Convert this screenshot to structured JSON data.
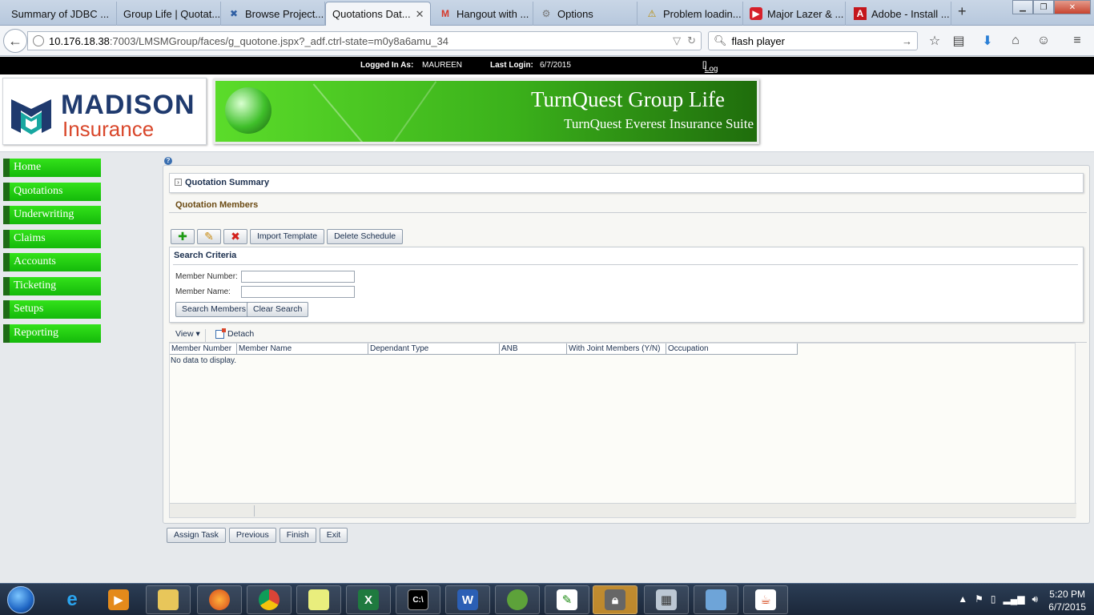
{
  "browser": {
    "tabs": [
      {
        "label": "Summary of JDBC ...",
        "icon": "page-icon"
      },
      {
        "label": "Group Life | Quotat...",
        "icon": "page-icon"
      },
      {
        "label": "Browse Project...",
        "icon": "jira-icon"
      },
      {
        "label": "Quotations Dat...",
        "icon": "page-icon",
        "active": true
      },
      {
        "label": "Hangout with ...",
        "icon": "gmail-icon"
      },
      {
        "label": "Options",
        "icon": "gear-icon"
      },
      {
        "label": "Problem loadin...",
        "icon": "warning-icon"
      },
      {
        "label": "Major Lazer & ...",
        "icon": "youtube-icon"
      },
      {
        "label": "Adobe - Install ...",
        "icon": "adobe-icon"
      }
    ],
    "url_host": "10.176.18.38",
    "url_rest": ":7003/LMSMGroup/faces/g_quotone.jspx?_adf.ctrl-state=m0y8a6amu_34",
    "search_value": "flash player"
  },
  "session": {
    "logged_in_label": "Logged In As:",
    "user": "MAUREEN",
    "last_login_label": "Last Login:",
    "last_login": "6/7/2015",
    "logout": "Log Out"
  },
  "branding": {
    "logo_line1": "MADISON",
    "logo_line2": "Insurance",
    "banner_title": "TurnQuest Group Life",
    "banner_subtitle": "TurnQuest Everest Insurance Suite"
  },
  "menu": [
    {
      "label": "Home"
    },
    {
      "label": "Quotations"
    },
    {
      "label": "Underwriting"
    },
    {
      "label": "Claims"
    },
    {
      "label": "Accounts"
    },
    {
      "label": "Ticketing"
    },
    {
      "label": "Setups"
    },
    {
      "label": "Reporting"
    }
  ],
  "main": {
    "help": "?",
    "summary_title": "Quotation Summary",
    "section_title": "Quotation Members",
    "toolbar": {
      "import_template": "Import Template",
      "delete_schedule": "Delete Schedule"
    },
    "search": {
      "title": "Search Criteria",
      "member_number_label": "Member Number:",
      "member_number_value": "",
      "member_name_label": "Member Name:",
      "member_name_value": "",
      "search_button": "Search Members",
      "clear_button": "Clear Search"
    },
    "table": {
      "view_label": "View",
      "detach_label": "Detach",
      "columns": [
        "Member Number",
        "Member Name",
        "Dependant Type",
        "ANB",
        "With Joint Members (Y/N)",
        "Occupation"
      ],
      "empty_text": "No data to display."
    },
    "footer_buttons": {
      "assign_task": "Assign Task",
      "previous": "Previous",
      "finish": "Finish",
      "exit": "Exit"
    }
  },
  "taskbar": {
    "apps": [
      "internet-explorer-icon",
      "media-player-icon",
      "file-explorer-icon",
      "firefox-icon",
      "chrome-icon",
      "sticky-notes-icon",
      "excel-icon",
      "cmd-icon",
      "word-icon",
      "frog-app-icon",
      "notepad-plus-icon",
      "vpn-lock-icon",
      "calculator-icon",
      "control-panel-icon",
      "java-icon"
    ],
    "time": "5:20 PM",
    "date": "6/7/2015"
  }
}
